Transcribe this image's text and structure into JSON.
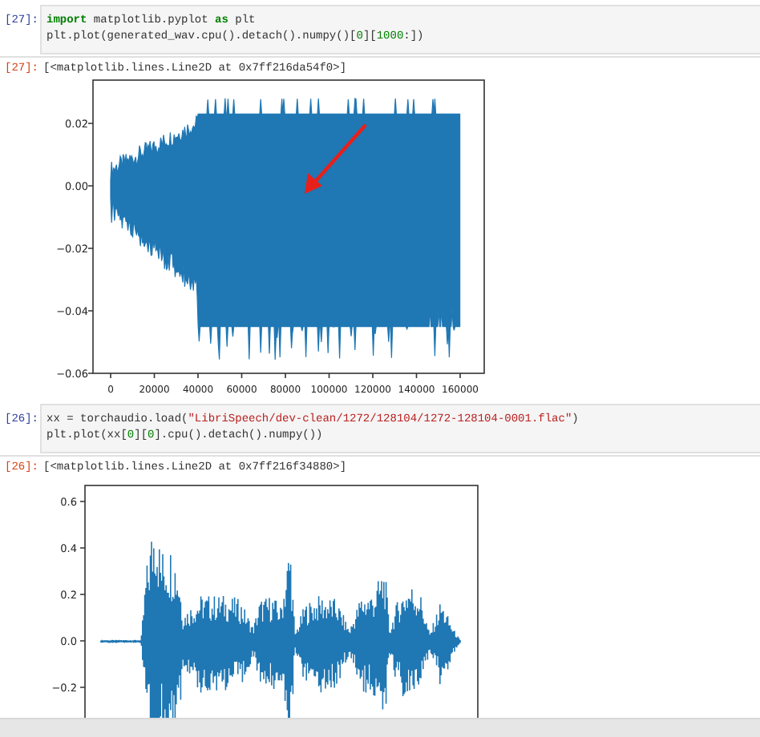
{
  "cells": [
    {
      "input_prompt": "[27]:",
      "code_lines": [
        [
          {
            "kind": "keyword",
            "text": "import"
          },
          {
            "kind": "plain",
            "text": " matplotlib.pyplot "
          },
          {
            "kind": "keyword",
            "text": "as"
          },
          {
            "kind": "plain",
            "text": " plt"
          }
        ],
        [
          {
            "kind": "plain",
            "text": "plt.plot(generated_wav.cpu().detach().numpy()["
          },
          {
            "kind": "number",
            "text": "0"
          },
          {
            "kind": "plain",
            "text": "]["
          },
          {
            "kind": "number",
            "text": "1000"
          },
          {
            "kind": "plain",
            "text": ":])"
          }
        ]
      ],
      "output_prompt": "[27]:",
      "output_text": "[<matplotlib.lines.Line2D at 0x7ff216da54f0>]",
      "plot": {
        "kind": "dense",
        "arrow": true,
        "yticks": [
          "0.02",
          "0.00",
          "−0.02",
          "−0.04",
          "−0.06"
        ],
        "xticks": [
          "0",
          "20000",
          "40000",
          "60000",
          "80000",
          "100000",
          "120000",
          "140000",
          "160000"
        ]
      }
    },
    {
      "input_prompt": "[26]:",
      "code_lines": [
        [
          {
            "kind": "plain",
            "text": "xx = torchaudio.load("
          },
          {
            "kind": "string",
            "text": "\"LibriSpeech/dev-clean/1272/128104/1272-128104-0001.flac\""
          },
          {
            "kind": "plain",
            "text": ")"
          }
        ],
        [
          {
            "kind": "plain",
            "text": "plt.plot(xx["
          },
          {
            "kind": "number",
            "text": "0"
          },
          {
            "kind": "plain",
            "text": "]["
          },
          {
            "kind": "number",
            "text": "0"
          },
          {
            "kind": "plain",
            "text": "].cpu().detach().numpy())"
          }
        ]
      ],
      "output_prompt": "[26]:",
      "output_text": "[<matplotlib.lines.Line2D at 0x7ff216f34880>]",
      "plot": {
        "kind": "speech",
        "yticks": [
          "0.6",
          "0.4",
          "0.2",
          "0.0",
          "−0.2"
        ]
      }
    }
  ]
}
